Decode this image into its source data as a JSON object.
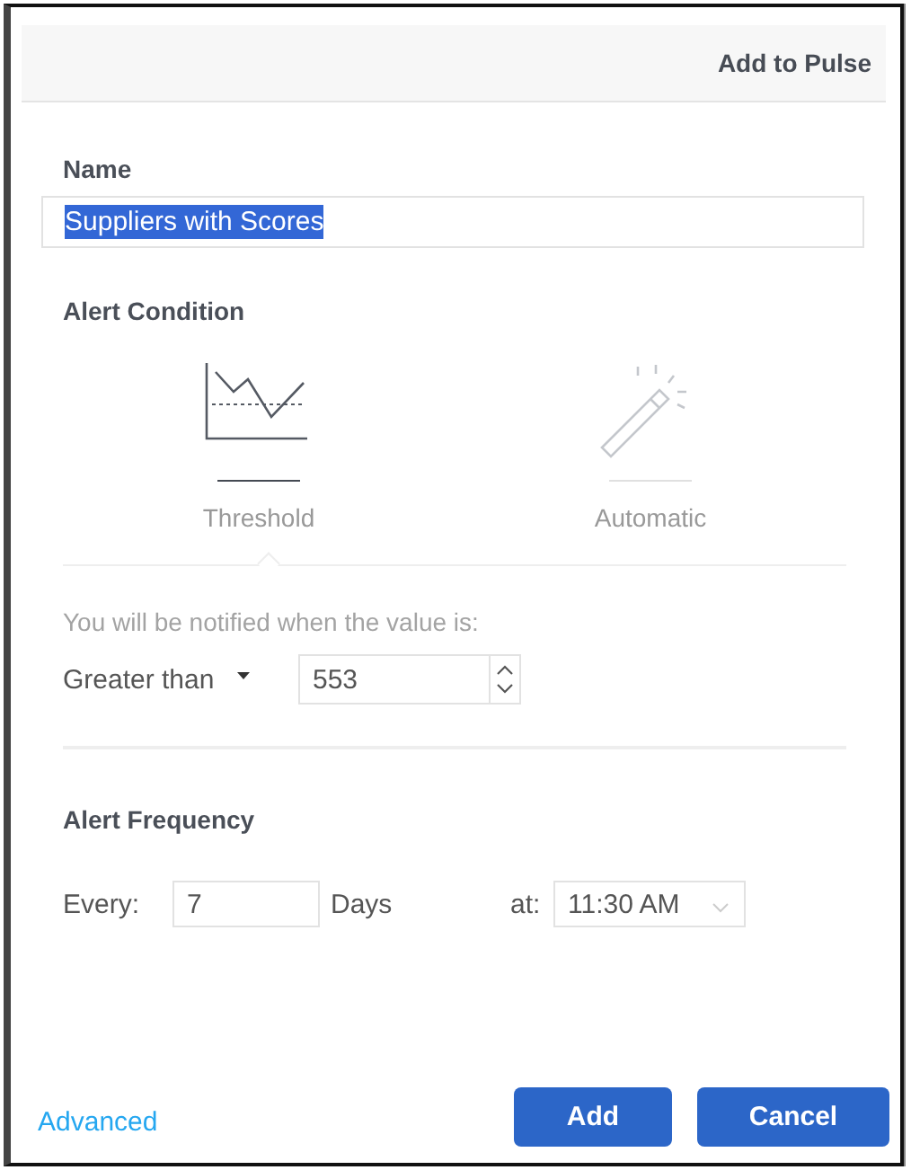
{
  "dialog": {
    "title": "Add to Pulse"
  },
  "name": {
    "label": "Name",
    "value": "Suppliers with Scores",
    "text_selected": true
  },
  "alert_condition": {
    "heading": "Alert Condition",
    "options": [
      {
        "label": "Threshold",
        "kind": "threshold",
        "selected": true
      },
      {
        "label": "Automatic",
        "kind": "automatic",
        "selected": false
      }
    ],
    "hint": "You will be notified when the value is:",
    "operator": "Greater than",
    "value": "553"
  },
  "alert_frequency": {
    "heading": "Alert Frequency",
    "every_label": "Every:",
    "every_value": "7",
    "unit": "Days",
    "at_label": "at:",
    "time": "11:30 AM"
  },
  "footer": {
    "link": "Advanced",
    "buttons": [
      "Add",
      "Cancel"
    ]
  }
}
